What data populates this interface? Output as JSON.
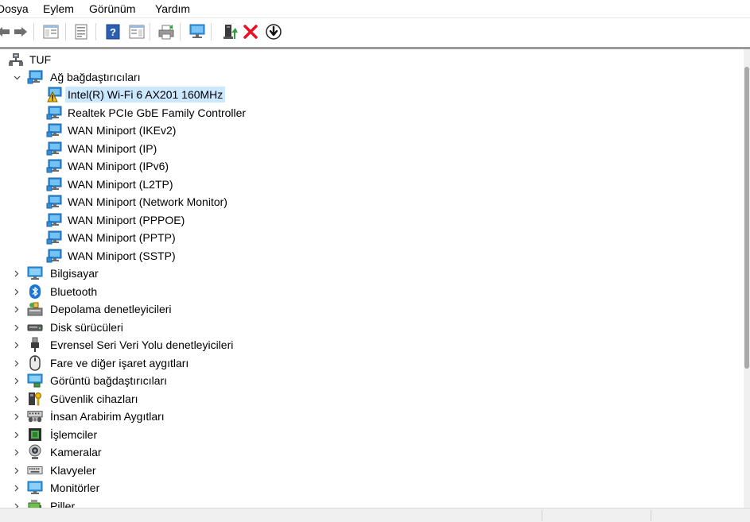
{
  "menu": {
    "file": "Dosya",
    "action": "Eylem",
    "view": "Görünüm",
    "help": "Yardım"
  },
  "tree": {
    "root": "TUF",
    "network": {
      "label": "Ağ bağdaştırıcıları",
      "children": [
        "Intel(R) Wi-Fi 6 AX201 160MHz",
        "Realtek PCIe GbE Family Controller",
        "WAN Miniport (IKEv2)",
        "WAN Miniport (IP)",
        "WAN Miniport (IPv6)",
        "WAN Miniport (L2TP)",
        "WAN Miniport (Network Monitor)",
        "WAN Miniport (PPPOE)",
        "WAN Miniport (PPTP)",
        "WAN Miniport (SSTP)"
      ]
    },
    "categories": [
      "Bilgisayar",
      "Bluetooth",
      "Depolama denetleyicileri",
      "Disk sürücüleri",
      "Evrensel Seri Veri Yolu denetleyicileri",
      "Fare ve diğer işaret aygıtları",
      "Görüntü bağdaştırıcıları",
      "Güvenlik cihazları",
      "İnsan Arabirim Aygıtları",
      "İşlemciler",
      "Kameralar",
      "Klavyeler",
      "Monitörler",
      "Piller"
    ]
  },
  "colors": {
    "selection": "#cce8ff",
    "network_icon": "#2f8fd8",
    "warning": "#f4c20d",
    "delete_x": "#e81123"
  }
}
